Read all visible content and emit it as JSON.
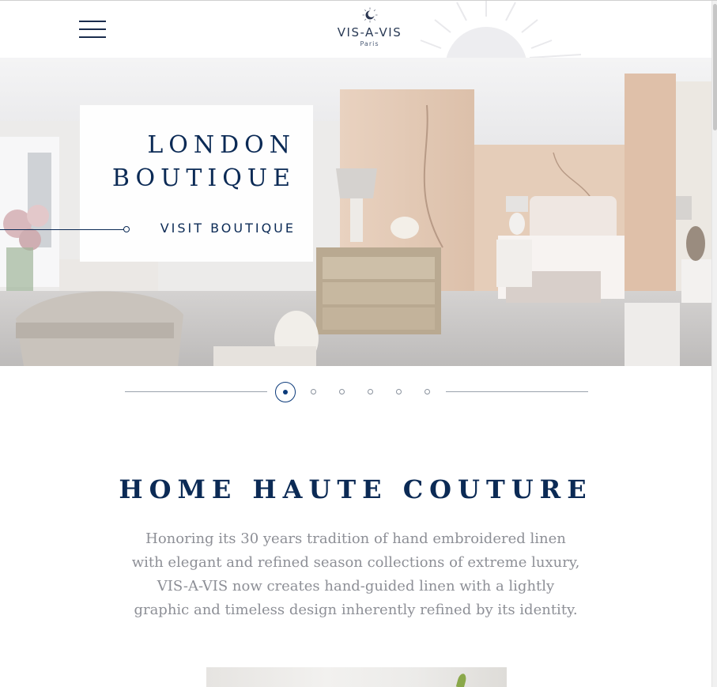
{
  "header": {
    "menu_icon": "hamburger-menu-icon",
    "logo": {
      "name": "VIS-A-VIS",
      "city": "Paris",
      "mark_icon": "sun-moon-logo-icon"
    }
  },
  "hero": {
    "title_line1": "LONDON",
    "title_line2": "BOUTIQUE",
    "cta_label": "VISIT BOUTIQUE",
    "image_description_icon": "boutique-interior-photo"
  },
  "pager": {
    "total": 6,
    "active": 1
  },
  "section": {
    "title": "HOME HAUTE COUTURE",
    "body": "Honoring its 30 years tradition of hand embroidered linen with elegant and refined season collections of extreme luxury, VIS-A-VIS now creates hand-guided linen with a lightly graphic and timeless design inherently refined by its identity."
  },
  "colors": {
    "navy": "#0b2a55",
    "body_text": "#8d8f96",
    "pager_active": "#0b3a7a"
  }
}
